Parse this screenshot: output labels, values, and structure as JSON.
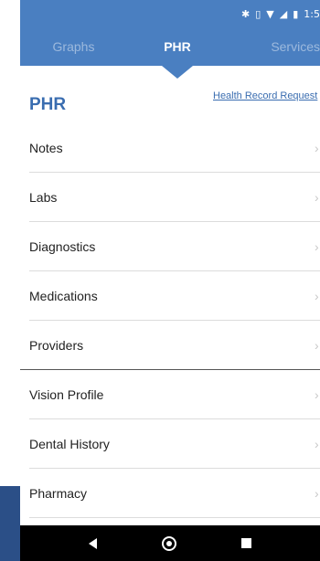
{
  "status_bar": {
    "icons": [
      "bluetooth-icon",
      "vibrate-icon",
      "wifi-icon",
      "signal-icon",
      "battery-icon"
    ],
    "time": "1:5"
  },
  "tabs": [
    {
      "label": "Graphs",
      "active": false
    },
    {
      "label": "PHR",
      "active": true
    },
    {
      "label": "Services",
      "active": false
    }
  ],
  "page": {
    "title": "PHR",
    "record_link": "Health Record Request"
  },
  "list": [
    {
      "label": "Notes"
    },
    {
      "label": "Labs"
    },
    {
      "label": "Diagnostics"
    },
    {
      "label": "Medications"
    },
    {
      "label": "Providers"
    },
    {
      "label": "Vision Profile"
    },
    {
      "label": "Dental History"
    },
    {
      "label": "Pharmacy"
    }
  ],
  "colors": {
    "header": "#4a7fc1",
    "accent": "#3a6db0",
    "nav": "#000000"
  }
}
